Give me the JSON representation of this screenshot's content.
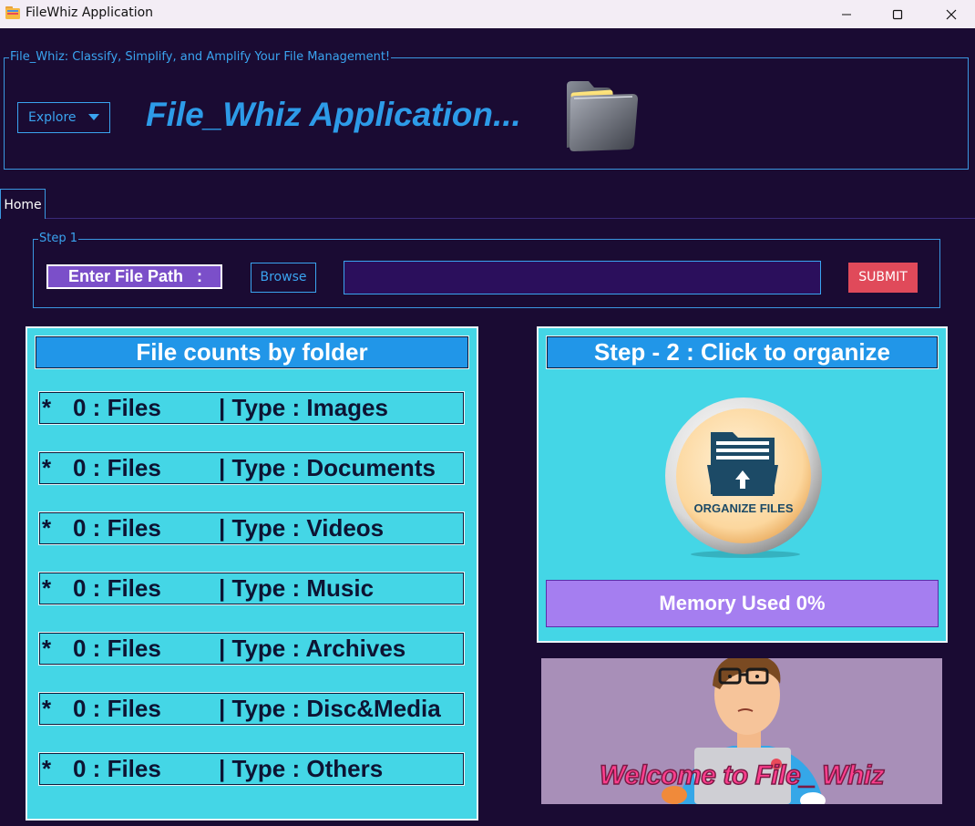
{
  "window": {
    "title": "FileWhiz Application",
    "controls": [
      "minimize-icon",
      "maximize-icon",
      "close-icon"
    ]
  },
  "header": {
    "legend": "File_Whiz: Classify, Simplify, and Amplify Your File Management!",
    "explore_label": "Explore",
    "heading": "File_Whiz Application..."
  },
  "tabs": [
    {
      "label": "Home",
      "active": true
    }
  ],
  "step1": {
    "legend": "Step 1",
    "path_label": "Enter File Path   :",
    "browse_label": "Browse",
    "path_value": "",
    "submit_label": "SUBMIT"
  },
  "file_counts": {
    "title": "File counts by folder",
    "rows": [
      {
        "bullet": "*",
        "count": "0 : Files",
        "type": "| Type : Images"
      },
      {
        "bullet": "*",
        "count": "0 : Files",
        "type": "| Type : Documents"
      },
      {
        "bullet": "*",
        "count": "0 : Files",
        "type": "| Type : Videos"
      },
      {
        "bullet": "*",
        "count": "0 : Files",
        "type": "| Type : Music"
      },
      {
        "bullet": "*",
        "count": "0 : Files",
        "type": "| Type : Archives"
      },
      {
        "bullet": "*",
        "count": "0 : Files",
        "type": "| Type : Disc&Media"
      },
      {
        "bullet": "*",
        "count": "0 : Files",
        "type": "| Type : Others"
      }
    ]
  },
  "step2": {
    "title": "Step - 2 : Click to organize",
    "organize_button_text": "ORGANIZE FILES",
    "memory_label": "Memory Used 0%"
  },
  "welcome": {
    "text": "Welcome to File_ Whiz"
  },
  "colors": {
    "background": "#1a0b33",
    "accent_blue": "#3aa4f0",
    "panel_cyan": "#44d6e6",
    "title_blue": "#2196e8",
    "submit_red": "#e04a5a",
    "label_purple": "#7b4fc9",
    "memory_purple": "#a57ef0"
  }
}
